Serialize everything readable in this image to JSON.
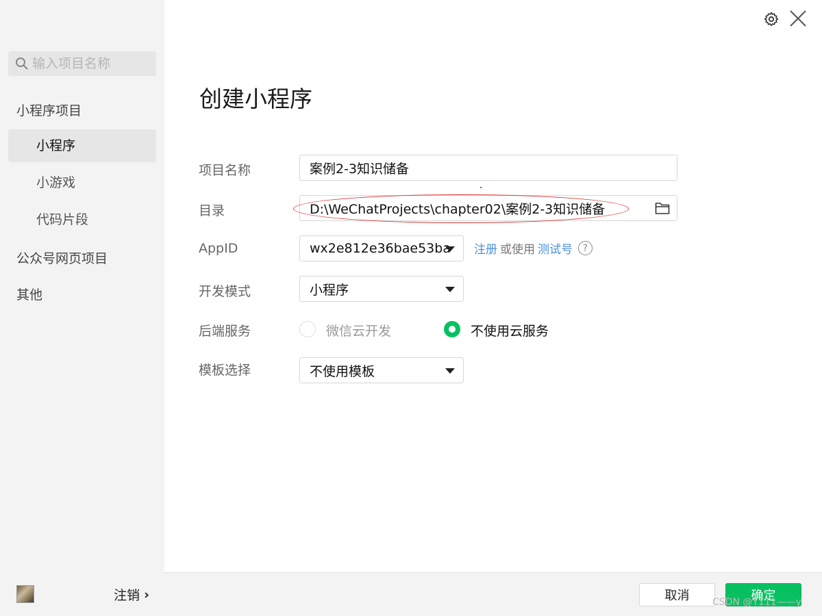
{
  "sidebar": {
    "search_placeholder": "输入项目名称",
    "group_miniprogram": "小程序项目",
    "items": [
      {
        "label": "小程序"
      },
      {
        "label": "小游戏"
      },
      {
        "label": "代码片段"
      }
    ],
    "group_official": "公众号网页项目",
    "group_other": "其他",
    "logout_label": "注销",
    "logout_arrow": "›"
  },
  "window": {
    "settings_icon": "gear-icon",
    "close_icon": "close-icon"
  },
  "dialog": {
    "title": "创建小程序",
    "fields": {
      "project_name": {
        "label": "项目名称",
        "value": "案例2-3知识储备"
      },
      "directory": {
        "label": "目录",
        "value": "D:\\WeChatProjects\\chapter02\\案例2-3知识储备"
      },
      "appid": {
        "label": "AppID",
        "value": "wx2e812e36bae53ba",
        "register_link": "注册",
        "or_use": "或使用",
        "test_account_link": "测试号",
        "help": "?"
      },
      "dev_mode": {
        "label": "开发模式",
        "value": "小程序"
      },
      "backend": {
        "label": "后端服务",
        "options": [
          {
            "label": "微信云开发",
            "selected": false
          },
          {
            "label": "不使用云服务",
            "selected": true
          }
        ]
      },
      "template": {
        "label": "模板选择",
        "value": "不使用模板"
      }
    }
  },
  "footer": {
    "cancel_label": "取消",
    "confirm_label": "确定"
  },
  "watermark": "CSDN @Y111——y",
  "colors": {
    "accent_green": "#07c160",
    "link_blue": "#4a90d9",
    "annotation_red": "#dd3333"
  }
}
